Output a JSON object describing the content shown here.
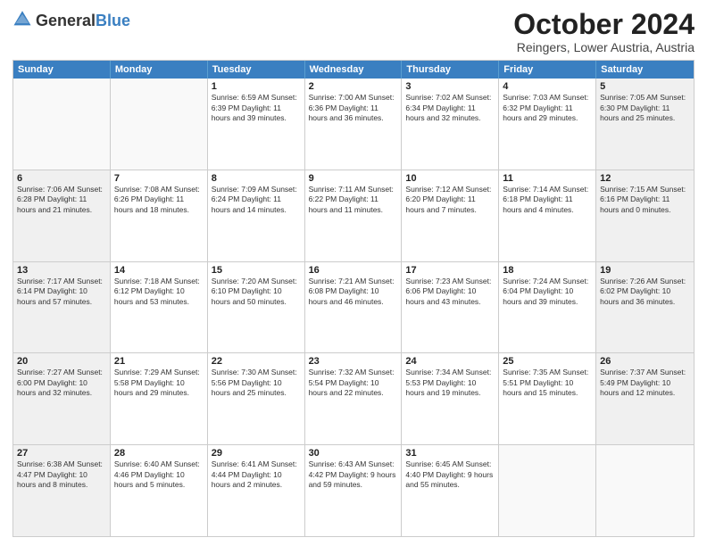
{
  "header": {
    "logo_general": "General",
    "logo_blue": "Blue",
    "month_title": "October 2024",
    "subtitle": "Reingers, Lower Austria, Austria"
  },
  "weekdays": [
    "Sunday",
    "Monday",
    "Tuesday",
    "Wednesday",
    "Thursday",
    "Friday",
    "Saturday"
  ],
  "rows": [
    [
      {
        "day": "",
        "text": "",
        "empty": true
      },
      {
        "day": "",
        "text": "",
        "empty": true
      },
      {
        "day": "1",
        "text": "Sunrise: 6:59 AM\nSunset: 6:39 PM\nDaylight: 11 hours and 39 minutes.",
        "empty": false
      },
      {
        "day": "2",
        "text": "Sunrise: 7:00 AM\nSunset: 6:36 PM\nDaylight: 11 hours and 36 minutes.",
        "empty": false
      },
      {
        "day": "3",
        "text": "Sunrise: 7:02 AM\nSunset: 6:34 PM\nDaylight: 11 hours and 32 minutes.",
        "empty": false
      },
      {
        "day": "4",
        "text": "Sunrise: 7:03 AM\nSunset: 6:32 PM\nDaylight: 11 hours and 29 minutes.",
        "empty": false
      },
      {
        "day": "5",
        "text": "Sunrise: 7:05 AM\nSunset: 6:30 PM\nDaylight: 11 hours and 25 minutes.",
        "empty": false,
        "shaded": true
      }
    ],
    [
      {
        "day": "6",
        "text": "Sunrise: 7:06 AM\nSunset: 6:28 PM\nDaylight: 11 hours and 21 minutes.",
        "empty": false,
        "shaded": true
      },
      {
        "day": "7",
        "text": "Sunrise: 7:08 AM\nSunset: 6:26 PM\nDaylight: 11 hours and 18 minutes.",
        "empty": false
      },
      {
        "day": "8",
        "text": "Sunrise: 7:09 AM\nSunset: 6:24 PM\nDaylight: 11 hours and 14 minutes.",
        "empty": false
      },
      {
        "day": "9",
        "text": "Sunrise: 7:11 AM\nSunset: 6:22 PM\nDaylight: 11 hours and 11 minutes.",
        "empty": false
      },
      {
        "day": "10",
        "text": "Sunrise: 7:12 AM\nSunset: 6:20 PM\nDaylight: 11 hours and 7 minutes.",
        "empty": false
      },
      {
        "day": "11",
        "text": "Sunrise: 7:14 AM\nSunset: 6:18 PM\nDaylight: 11 hours and 4 minutes.",
        "empty": false
      },
      {
        "day": "12",
        "text": "Sunrise: 7:15 AM\nSunset: 6:16 PM\nDaylight: 11 hours and 0 minutes.",
        "empty": false,
        "shaded": true
      }
    ],
    [
      {
        "day": "13",
        "text": "Sunrise: 7:17 AM\nSunset: 6:14 PM\nDaylight: 10 hours and 57 minutes.",
        "empty": false,
        "shaded": true
      },
      {
        "day": "14",
        "text": "Sunrise: 7:18 AM\nSunset: 6:12 PM\nDaylight: 10 hours and 53 minutes.",
        "empty": false
      },
      {
        "day": "15",
        "text": "Sunrise: 7:20 AM\nSunset: 6:10 PM\nDaylight: 10 hours and 50 minutes.",
        "empty": false
      },
      {
        "day": "16",
        "text": "Sunrise: 7:21 AM\nSunset: 6:08 PM\nDaylight: 10 hours and 46 minutes.",
        "empty": false
      },
      {
        "day": "17",
        "text": "Sunrise: 7:23 AM\nSunset: 6:06 PM\nDaylight: 10 hours and 43 minutes.",
        "empty": false
      },
      {
        "day": "18",
        "text": "Sunrise: 7:24 AM\nSunset: 6:04 PM\nDaylight: 10 hours and 39 minutes.",
        "empty": false
      },
      {
        "day": "19",
        "text": "Sunrise: 7:26 AM\nSunset: 6:02 PM\nDaylight: 10 hours and 36 minutes.",
        "empty": false,
        "shaded": true
      }
    ],
    [
      {
        "day": "20",
        "text": "Sunrise: 7:27 AM\nSunset: 6:00 PM\nDaylight: 10 hours and 32 minutes.",
        "empty": false,
        "shaded": true
      },
      {
        "day": "21",
        "text": "Sunrise: 7:29 AM\nSunset: 5:58 PM\nDaylight: 10 hours and 29 minutes.",
        "empty": false
      },
      {
        "day": "22",
        "text": "Sunrise: 7:30 AM\nSunset: 5:56 PM\nDaylight: 10 hours and 25 minutes.",
        "empty": false
      },
      {
        "day": "23",
        "text": "Sunrise: 7:32 AM\nSunset: 5:54 PM\nDaylight: 10 hours and 22 minutes.",
        "empty": false
      },
      {
        "day": "24",
        "text": "Sunrise: 7:34 AM\nSunset: 5:53 PM\nDaylight: 10 hours and 19 minutes.",
        "empty": false
      },
      {
        "day": "25",
        "text": "Sunrise: 7:35 AM\nSunset: 5:51 PM\nDaylight: 10 hours and 15 minutes.",
        "empty": false
      },
      {
        "day": "26",
        "text": "Sunrise: 7:37 AM\nSunset: 5:49 PM\nDaylight: 10 hours and 12 minutes.",
        "empty": false,
        "shaded": true
      }
    ],
    [
      {
        "day": "27",
        "text": "Sunrise: 6:38 AM\nSunset: 4:47 PM\nDaylight: 10 hours and 8 minutes.",
        "empty": false,
        "shaded": true
      },
      {
        "day": "28",
        "text": "Sunrise: 6:40 AM\nSunset: 4:46 PM\nDaylight: 10 hours and 5 minutes.",
        "empty": false
      },
      {
        "day": "29",
        "text": "Sunrise: 6:41 AM\nSunset: 4:44 PM\nDaylight: 10 hours and 2 minutes.",
        "empty": false
      },
      {
        "day": "30",
        "text": "Sunrise: 6:43 AM\nSunset: 4:42 PM\nDaylight: 9 hours and 59 minutes.",
        "empty": false
      },
      {
        "day": "31",
        "text": "Sunrise: 6:45 AM\nSunset: 4:40 PM\nDaylight: 9 hours and 55 minutes.",
        "empty": false
      },
      {
        "day": "",
        "text": "",
        "empty": true
      },
      {
        "day": "",
        "text": "",
        "empty": true
      }
    ]
  ]
}
